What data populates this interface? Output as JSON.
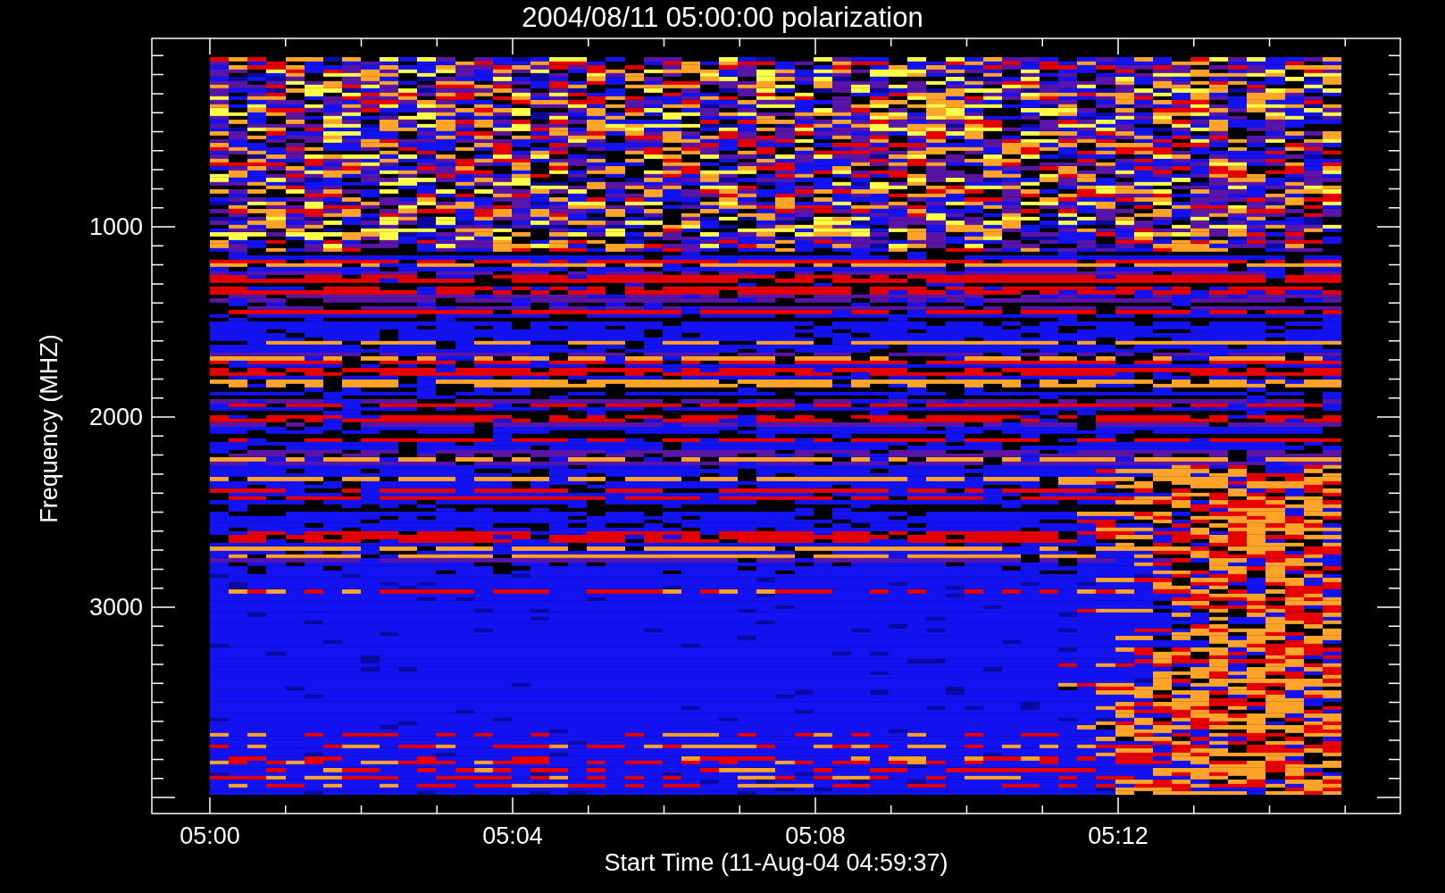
{
  "plot": {
    "title": "2004/08/11 05:00:00 polarization",
    "xlabel": "Start Time (11-Aug-04 04:59:37)",
    "ylabel": "Frequency (MHZ)",
    "xticks": [
      "05:00",
      "05:04",
      "05:08",
      "05:12"
    ],
    "yticks": [
      "1000",
      "2000",
      "3000"
    ]
  }
}
